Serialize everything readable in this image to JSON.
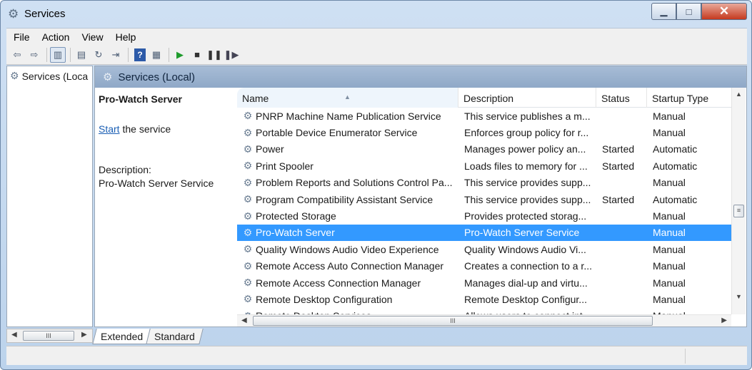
{
  "window": {
    "title": "Services",
    "min_glyph": "▁",
    "max_glyph": "□",
    "close_glyph": "✕"
  },
  "menu": [
    "File",
    "Action",
    "View",
    "Help"
  ],
  "tree": {
    "root_label": "Services (Loca"
  },
  "header": {
    "title": "Services (Local)"
  },
  "details": {
    "service_name": "Pro-Watch Server",
    "start_link": "Start",
    "start_suffix": " the service",
    "description_label": "Description:",
    "description_text": "Pro-Watch Server Service"
  },
  "columns": {
    "name": "Name",
    "description": "Description",
    "status": "Status",
    "startup": "Startup Type"
  },
  "services": [
    {
      "name": "PNRP Machine Name Publication Service",
      "description": "This service publishes a m...",
      "status": "",
      "startup": "Manual"
    },
    {
      "name": "Portable Device Enumerator Service",
      "description": "Enforces group policy for r...",
      "status": "",
      "startup": "Manual"
    },
    {
      "name": "Power",
      "description": "Manages power policy an...",
      "status": "Started",
      "startup": "Automatic"
    },
    {
      "name": "Print Spooler",
      "description": "Loads files to memory for ...",
      "status": "Started",
      "startup": "Automatic"
    },
    {
      "name": "Problem Reports and Solutions Control Pa...",
      "description": "This service provides supp...",
      "status": "",
      "startup": "Manual"
    },
    {
      "name": "Program Compatibility Assistant Service",
      "description": "This service provides supp...",
      "status": "Started",
      "startup": "Automatic"
    },
    {
      "name": "Protected Storage",
      "description": "Provides protected storag...",
      "status": "",
      "startup": "Manual"
    },
    {
      "name": "Pro-Watch Server",
      "description": "Pro-Watch Server Service",
      "status": "",
      "startup": "Manual",
      "selected": true
    },
    {
      "name": "Quality Windows Audio Video Experience",
      "description": "Quality Windows Audio Vi...",
      "status": "",
      "startup": "Manual"
    },
    {
      "name": "Remote Access Auto Connection Manager",
      "description": "Creates a connection to a r...",
      "status": "",
      "startup": "Manual"
    },
    {
      "name": "Remote Access Connection Manager",
      "description": "Manages dial-up and virtu...",
      "status": "",
      "startup": "Manual"
    },
    {
      "name": "Remote Desktop Configuration",
      "description": "Remote Desktop Configur...",
      "status": "",
      "startup": "Manual"
    },
    {
      "name": "Remote Desktop Services",
      "description": "Allows users to connect int...",
      "status": "",
      "startup": "Manual"
    }
  ],
  "tabs": [
    "Extended",
    "Standard"
  ],
  "icons": {
    "app": "gear-icon",
    "toolbar": [
      "back-arrow-icon",
      "forward-arrow-icon",
      "show-hide-console-tree-icon",
      "properties-icon",
      "refresh-icon",
      "export-list-icon",
      "help-icon",
      "show-action-pane-icon",
      "start-service-icon",
      "stop-service-icon",
      "pause-service-icon",
      "restart-service-icon"
    ]
  },
  "colors": {
    "selection": "#3399ff",
    "link": "#1b5fb4",
    "header_bar": "#9bb2cf"
  }
}
